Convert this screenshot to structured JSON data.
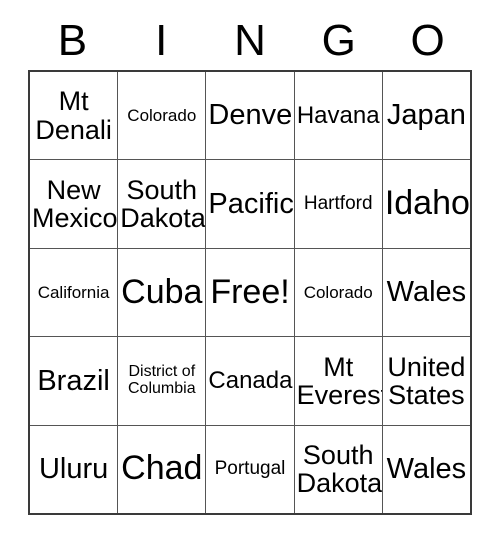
{
  "card": {
    "header": {
      "letters": [
        "B",
        "I",
        "N",
        "G",
        "O"
      ]
    },
    "rows": [
      [
        {
          "text": "Mt\nDenali",
          "size": "fs-lg"
        },
        {
          "text": "Colorado",
          "size": "fs-xs"
        },
        {
          "text": "Denver",
          "size": "fs-xl"
        },
        {
          "text": "Havana",
          "size": "fs-md"
        },
        {
          "text": "Japan",
          "size": "fs-xl"
        }
      ],
      [
        {
          "text": "New\nMexico",
          "size": "fs-lg"
        },
        {
          "text": "South\nDakota",
          "size": "fs-lg"
        },
        {
          "text": "Pacific",
          "size": "fs-xl"
        },
        {
          "text": "Hartford",
          "size": "fs-sm"
        },
        {
          "text": "Idaho",
          "size": "fs-xxl"
        }
      ],
      [
        {
          "text": "California",
          "size": "fs-xs"
        },
        {
          "text": "Cuba",
          "size": "fs-xxl"
        },
        {
          "text": "Free!",
          "size": "fs-xxl"
        },
        {
          "text": "Colorado",
          "size": "fs-xs"
        },
        {
          "text": "Wales",
          "size": "fs-xl"
        }
      ],
      [
        {
          "text": "Brazil",
          "size": "fs-xl"
        },
        {
          "text": "District of\nColumbia",
          "size": "fs-xxs"
        },
        {
          "text": "Canada",
          "size": "fs-md"
        },
        {
          "text": "Mt\nEverest",
          "size": "fs-lg"
        },
        {
          "text": "United\nStates",
          "size": "fs-lg"
        }
      ],
      [
        {
          "text": "Uluru",
          "size": "fs-xl"
        },
        {
          "text": "Chad",
          "size": "fs-xxl"
        },
        {
          "text": "Portugal",
          "size": "fs-sm"
        },
        {
          "text": "South\nDakota",
          "size": "fs-lg"
        },
        {
          "text": "Wales",
          "size": "fs-xl"
        }
      ]
    ]
  }
}
